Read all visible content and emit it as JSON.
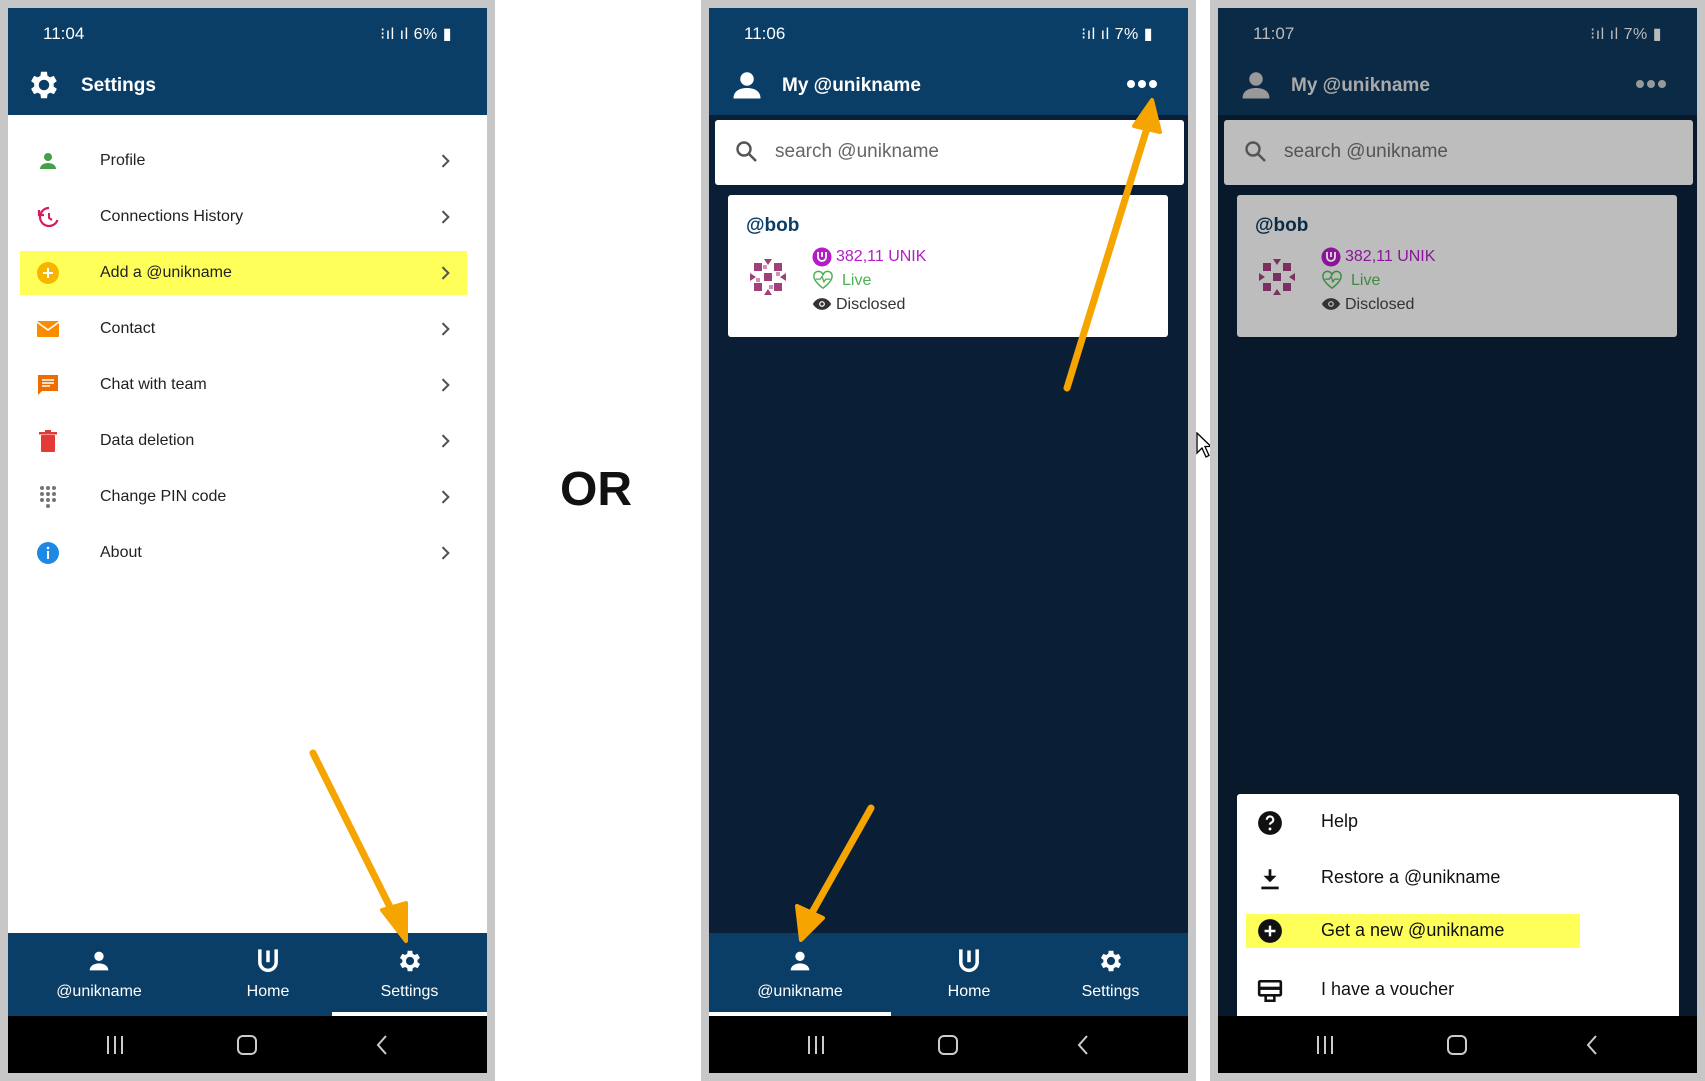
{
  "colors": {
    "brand_blue": "#0b3e66",
    "dark_bg": "#0a1f36",
    "highlight": "#ffff5a",
    "arrow": "#f5a400",
    "purple": "#b41cc8",
    "green": "#4caf50"
  },
  "separator_text": "OR",
  "screen1": {
    "time": "11:04",
    "battery": "6%",
    "title": "Settings",
    "items": [
      {
        "label": "Profile",
        "icon": "person-icon"
      },
      {
        "label": "Connections History",
        "icon": "history-icon"
      },
      {
        "label": "Add a @unikname",
        "icon": "add-circle-icon",
        "highlighted": true
      },
      {
        "label": "Contact",
        "icon": "mail-icon"
      },
      {
        "label": "Chat with team",
        "icon": "chat-icon"
      },
      {
        "label": "Data deletion",
        "icon": "trash-icon"
      },
      {
        "label": "Change PIN code",
        "icon": "dialpad-icon"
      },
      {
        "label": "About",
        "icon": "info-icon"
      }
    ],
    "tabs": [
      "@unikname",
      "Home",
      "Settings"
    ],
    "active_tab": "Settings"
  },
  "screen2": {
    "time": "11:06",
    "battery": "7%",
    "title": "My @unikname",
    "search_placeholder": "search @unikname",
    "card": {
      "name": "@bob",
      "balance": "382,11 UNIK",
      "status": "Live",
      "visibility": "Disclosed"
    },
    "tabs": [
      "@unikname",
      "Home",
      "Settings"
    ],
    "active_tab": "@unikname"
  },
  "screen3": {
    "time": "11:07",
    "battery": "7%",
    "title": "My @unikname",
    "search_placeholder": "search @unikname",
    "card": {
      "name": "@bob",
      "balance": "382,11 UNIK",
      "status": "Live",
      "visibility": "Disclosed"
    },
    "menu": [
      {
        "label": "Help",
        "icon": "help-icon"
      },
      {
        "label": "Restore a @unikname",
        "icon": "download-icon"
      },
      {
        "label": "Get a new @unikname",
        "icon": "add-circle-icon",
        "highlighted": true
      },
      {
        "label": "I have a voucher",
        "icon": "voucher-icon"
      }
    ]
  }
}
